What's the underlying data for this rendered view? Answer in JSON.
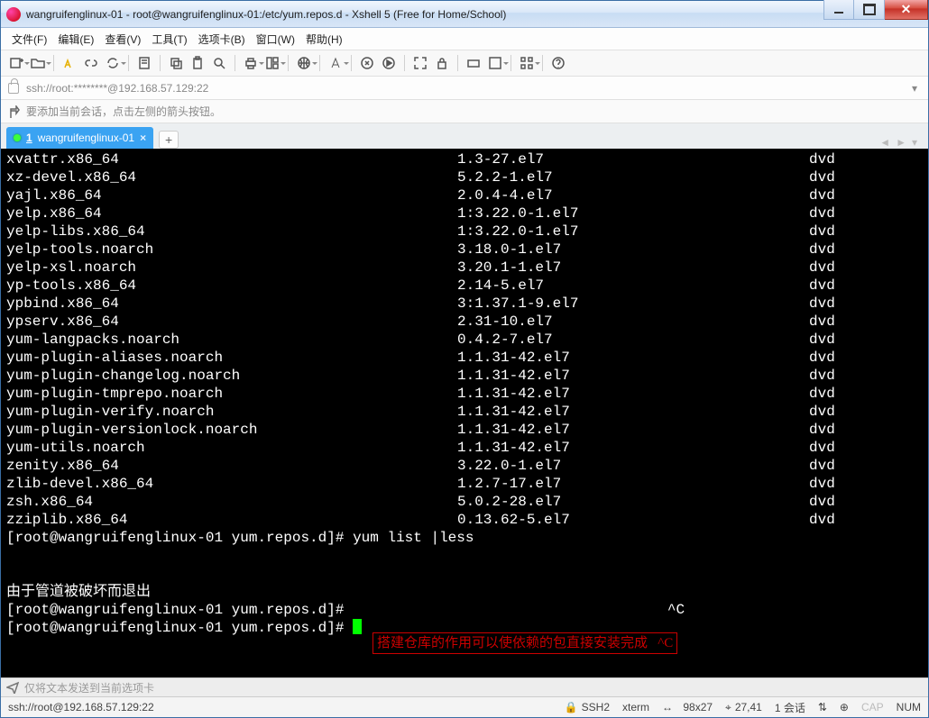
{
  "window": {
    "title": "wangruifenglinux-01 - root@wangruifenglinux-01:/etc/yum.repos.d - Xshell 5 (Free for Home/School)"
  },
  "menu": {
    "file": "文件(F)",
    "edit": "编辑(E)",
    "view": "查看(V)",
    "tools": "工具(T)",
    "tabs": "选项卡(B)",
    "window": "窗口(W)",
    "help": "帮助(H)"
  },
  "address": {
    "value": "ssh://root:********@192.168.57.129:22"
  },
  "infoline": {
    "text": "要添加当前会话，点击左侧的箭头按钮。"
  },
  "tab": {
    "index": "1",
    "label": "wangruifenglinux-01"
  },
  "packages": [
    {
      "name": "xvattr.x86_64",
      "ver": "1.3-27.el7",
      "repo": "dvd"
    },
    {
      "name": "xz-devel.x86_64",
      "ver": "5.2.2-1.el7",
      "repo": "dvd"
    },
    {
      "name": "yajl.x86_64",
      "ver": "2.0.4-4.el7",
      "repo": "dvd"
    },
    {
      "name": "yelp.x86_64",
      "ver": "1:3.22.0-1.el7",
      "repo": "dvd"
    },
    {
      "name": "yelp-libs.x86_64",
      "ver": "1:3.22.0-1.el7",
      "repo": "dvd"
    },
    {
      "name": "yelp-tools.noarch",
      "ver": "3.18.0-1.el7",
      "repo": "dvd"
    },
    {
      "name": "yelp-xsl.noarch",
      "ver": "3.20.1-1.el7",
      "repo": "dvd"
    },
    {
      "name": "yp-tools.x86_64",
      "ver": "2.14-5.el7",
      "repo": "dvd"
    },
    {
      "name": "ypbind.x86_64",
      "ver": "3:1.37.1-9.el7",
      "repo": "dvd"
    },
    {
      "name": "ypserv.x86_64",
      "ver": "2.31-10.el7",
      "repo": "dvd"
    },
    {
      "name": "yum-langpacks.noarch",
      "ver": "0.4.2-7.el7",
      "repo": "dvd"
    },
    {
      "name": "yum-plugin-aliases.noarch",
      "ver": "1.1.31-42.el7",
      "repo": "dvd"
    },
    {
      "name": "yum-plugin-changelog.noarch",
      "ver": "1.1.31-42.el7",
      "repo": "dvd"
    },
    {
      "name": "yum-plugin-tmprepo.noarch",
      "ver": "1.1.31-42.el7",
      "repo": "dvd"
    },
    {
      "name": "yum-plugin-verify.noarch",
      "ver": "1.1.31-42.el7",
      "repo": "dvd"
    },
    {
      "name": "yum-plugin-versionlock.noarch",
      "ver": "1.1.31-42.el7",
      "repo": "dvd"
    },
    {
      "name": "yum-utils.noarch",
      "ver": "1.1.31-42.el7",
      "repo": "dvd"
    },
    {
      "name": "zenity.x86_64",
      "ver": "3.22.0-1.el7",
      "repo": "dvd"
    },
    {
      "name": "zlib-devel.x86_64",
      "ver": "1.2.7-17.el7",
      "repo": "dvd"
    },
    {
      "name": "zsh.x86_64",
      "ver": "5.0.2-28.el7",
      "repo": "dvd"
    },
    {
      "name": "zziplib.x86_64",
      "ver": "0.13.62-5.el7",
      "repo": "dvd"
    }
  ],
  "shell": {
    "prompt1": "[root@wangruifenglinux-01 yum.repos.d]# yum list |less",
    "blank": "",
    "pipeerr": "由于管道被破坏而退出",
    "prompt2p": "[root@wangruifenglinux-01 yum.repos.d]# ",
    "annot": "搭建仓库的作用可以使依赖的包直接安装完成",
    "ctrlc": "^C",
    "prompt3": "[root@wangruifenglinux-01 yum.repos.d]# "
  },
  "sendbar": {
    "placeholder": "仅将文本发送到当前选项卡"
  },
  "status": {
    "conn": "ssh://root@192.168.57.129:22",
    "proto": "SSH2",
    "term": "xterm",
    "size": "98x27",
    "pos": "27,41",
    "session": "1 会话",
    "cap": "CAP",
    "num": "NUM"
  }
}
